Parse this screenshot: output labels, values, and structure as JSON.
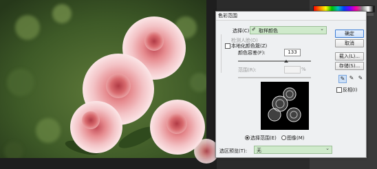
{
  "dialog": {
    "title": "色彩范围",
    "close_icon": "close-icon",
    "select_label": "选择(C):",
    "select_value": "取样颜色",
    "select_icon": "eyedropper-icon",
    "detect_faces_label": "检测人脸(D)",
    "localized_clusters_label": "本地化颜色簇(Z)",
    "fuzziness_label": "颜色容差(F):",
    "fuzziness_value": "133",
    "fuzziness_fraction": 0.66,
    "range_label": "范围(R):",
    "range_value": "",
    "range_unit": "%",
    "radio_selection_label": "选择范围(E)",
    "radio_image_label": "图像(M)",
    "preview_label": "选区预览(T):",
    "preview_value": "无",
    "buttons": {
      "ok": "确定",
      "cancel": "取消",
      "load": "载入(L)...",
      "save": "存储(S)..."
    },
    "invert_label": "反相(I)"
  },
  "colors": {
    "dialog_bg": "#eef0f2",
    "select_bg": "#cfeacb",
    "default_button_border": "#3a7bd5"
  }
}
